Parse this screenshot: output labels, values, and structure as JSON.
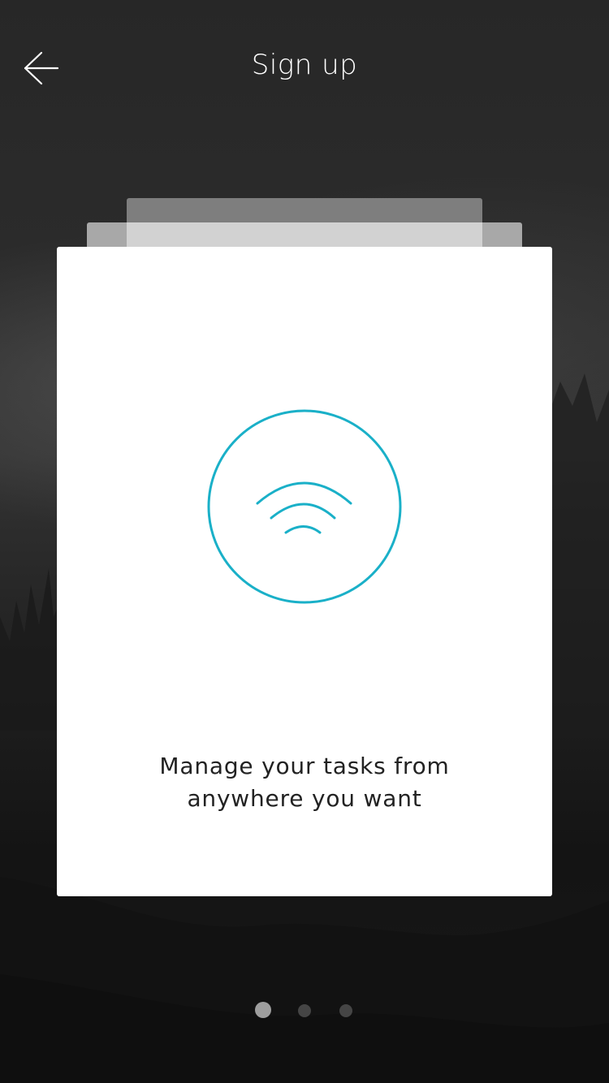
{
  "header": {
    "title": "Sign up",
    "back_icon": "arrow-left-icon"
  },
  "card": {
    "icon": "wifi-icon",
    "text_line1": "Manage your tasks from",
    "text_line2": "anywhere you want"
  },
  "pagination": {
    "pages": 3,
    "active_page": 1
  },
  "colors": {
    "accent": "#1AB0C8",
    "card_background": "#FFFFFF",
    "screen_background": "#262626"
  }
}
